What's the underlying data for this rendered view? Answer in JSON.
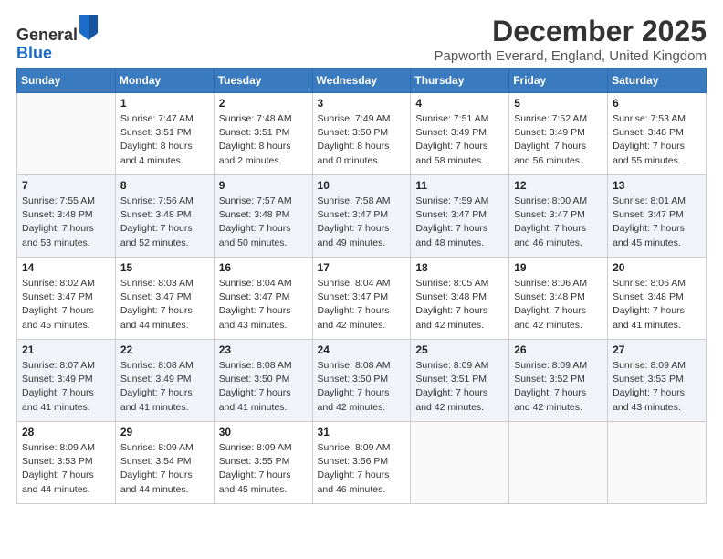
{
  "logo": {
    "line1": "General",
    "line2": "Blue"
  },
  "title": "December 2025",
  "location": "Papworth Everard, England, United Kingdom",
  "days_of_week": [
    "Sunday",
    "Monday",
    "Tuesday",
    "Wednesday",
    "Thursday",
    "Friday",
    "Saturday"
  ],
  "weeks": [
    [
      {
        "day": "",
        "sunrise": "",
        "sunset": "",
        "daylight": "",
        "empty": true
      },
      {
        "day": "1",
        "sunrise": "Sunrise: 7:47 AM",
        "sunset": "Sunset: 3:51 PM",
        "daylight": "Daylight: 8 hours and 4 minutes.",
        "empty": false
      },
      {
        "day": "2",
        "sunrise": "Sunrise: 7:48 AM",
        "sunset": "Sunset: 3:51 PM",
        "daylight": "Daylight: 8 hours and 2 minutes.",
        "empty": false
      },
      {
        "day": "3",
        "sunrise": "Sunrise: 7:49 AM",
        "sunset": "Sunset: 3:50 PM",
        "daylight": "Daylight: 8 hours and 0 minutes.",
        "empty": false
      },
      {
        "day": "4",
        "sunrise": "Sunrise: 7:51 AM",
        "sunset": "Sunset: 3:49 PM",
        "daylight": "Daylight: 7 hours and 58 minutes.",
        "empty": false
      },
      {
        "day": "5",
        "sunrise": "Sunrise: 7:52 AM",
        "sunset": "Sunset: 3:49 PM",
        "daylight": "Daylight: 7 hours and 56 minutes.",
        "empty": false
      },
      {
        "day": "6",
        "sunrise": "Sunrise: 7:53 AM",
        "sunset": "Sunset: 3:48 PM",
        "daylight": "Daylight: 7 hours and 55 minutes.",
        "empty": false
      }
    ],
    [
      {
        "day": "7",
        "sunrise": "Sunrise: 7:55 AM",
        "sunset": "Sunset: 3:48 PM",
        "daylight": "Daylight: 7 hours and 53 minutes.",
        "empty": false
      },
      {
        "day": "8",
        "sunrise": "Sunrise: 7:56 AM",
        "sunset": "Sunset: 3:48 PM",
        "daylight": "Daylight: 7 hours and 52 minutes.",
        "empty": false
      },
      {
        "day": "9",
        "sunrise": "Sunrise: 7:57 AM",
        "sunset": "Sunset: 3:48 PM",
        "daylight": "Daylight: 7 hours and 50 minutes.",
        "empty": false
      },
      {
        "day": "10",
        "sunrise": "Sunrise: 7:58 AM",
        "sunset": "Sunset: 3:47 PM",
        "daylight": "Daylight: 7 hours and 49 minutes.",
        "empty": false
      },
      {
        "day": "11",
        "sunrise": "Sunrise: 7:59 AM",
        "sunset": "Sunset: 3:47 PM",
        "daylight": "Daylight: 7 hours and 48 minutes.",
        "empty": false
      },
      {
        "day": "12",
        "sunrise": "Sunrise: 8:00 AM",
        "sunset": "Sunset: 3:47 PM",
        "daylight": "Daylight: 7 hours and 46 minutes.",
        "empty": false
      },
      {
        "day": "13",
        "sunrise": "Sunrise: 8:01 AM",
        "sunset": "Sunset: 3:47 PM",
        "daylight": "Daylight: 7 hours and 45 minutes.",
        "empty": false
      }
    ],
    [
      {
        "day": "14",
        "sunrise": "Sunrise: 8:02 AM",
        "sunset": "Sunset: 3:47 PM",
        "daylight": "Daylight: 7 hours and 45 minutes.",
        "empty": false
      },
      {
        "day": "15",
        "sunrise": "Sunrise: 8:03 AM",
        "sunset": "Sunset: 3:47 PM",
        "daylight": "Daylight: 7 hours and 44 minutes.",
        "empty": false
      },
      {
        "day": "16",
        "sunrise": "Sunrise: 8:04 AM",
        "sunset": "Sunset: 3:47 PM",
        "daylight": "Daylight: 7 hours and 43 minutes.",
        "empty": false
      },
      {
        "day": "17",
        "sunrise": "Sunrise: 8:04 AM",
        "sunset": "Sunset: 3:47 PM",
        "daylight": "Daylight: 7 hours and 42 minutes.",
        "empty": false
      },
      {
        "day": "18",
        "sunrise": "Sunrise: 8:05 AM",
        "sunset": "Sunset: 3:48 PM",
        "daylight": "Daylight: 7 hours and 42 minutes.",
        "empty": false
      },
      {
        "day": "19",
        "sunrise": "Sunrise: 8:06 AM",
        "sunset": "Sunset: 3:48 PM",
        "daylight": "Daylight: 7 hours and 42 minutes.",
        "empty": false
      },
      {
        "day": "20",
        "sunrise": "Sunrise: 8:06 AM",
        "sunset": "Sunset: 3:48 PM",
        "daylight": "Daylight: 7 hours and 41 minutes.",
        "empty": false
      }
    ],
    [
      {
        "day": "21",
        "sunrise": "Sunrise: 8:07 AM",
        "sunset": "Sunset: 3:49 PM",
        "daylight": "Daylight: 7 hours and 41 minutes.",
        "empty": false
      },
      {
        "day": "22",
        "sunrise": "Sunrise: 8:08 AM",
        "sunset": "Sunset: 3:49 PM",
        "daylight": "Daylight: 7 hours and 41 minutes.",
        "empty": false
      },
      {
        "day": "23",
        "sunrise": "Sunrise: 8:08 AM",
        "sunset": "Sunset: 3:50 PM",
        "daylight": "Daylight: 7 hours and 41 minutes.",
        "empty": false
      },
      {
        "day": "24",
        "sunrise": "Sunrise: 8:08 AM",
        "sunset": "Sunset: 3:50 PM",
        "daylight": "Daylight: 7 hours and 42 minutes.",
        "empty": false
      },
      {
        "day": "25",
        "sunrise": "Sunrise: 8:09 AM",
        "sunset": "Sunset: 3:51 PM",
        "daylight": "Daylight: 7 hours and 42 minutes.",
        "empty": false
      },
      {
        "day": "26",
        "sunrise": "Sunrise: 8:09 AM",
        "sunset": "Sunset: 3:52 PM",
        "daylight": "Daylight: 7 hours and 42 minutes.",
        "empty": false
      },
      {
        "day": "27",
        "sunrise": "Sunrise: 8:09 AM",
        "sunset": "Sunset: 3:53 PM",
        "daylight": "Daylight: 7 hours and 43 minutes.",
        "empty": false
      }
    ],
    [
      {
        "day": "28",
        "sunrise": "Sunrise: 8:09 AM",
        "sunset": "Sunset: 3:53 PM",
        "daylight": "Daylight: 7 hours and 44 minutes.",
        "empty": false
      },
      {
        "day": "29",
        "sunrise": "Sunrise: 8:09 AM",
        "sunset": "Sunset: 3:54 PM",
        "daylight": "Daylight: 7 hours and 44 minutes.",
        "empty": false
      },
      {
        "day": "30",
        "sunrise": "Sunrise: 8:09 AM",
        "sunset": "Sunset: 3:55 PM",
        "daylight": "Daylight: 7 hours and 45 minutes.",
        "empty": false
      },
      {
        "day": "31",
        "sunrise": "Sunrise: 8:09 AM",
        "sunset": "Sunset: 3:56 PM",
        "daylight": "Daylight: 7 hours and 46 minutes.",
        "empty": false
      },
      {
        "day": "",
        "sunrise": "",
        "sunset": "",
        "daylight": "",
        "empty": true
      },
      {
        "day": "",
        "sunrise": "",
        "sunset": "",
        "daylight": "",
        "empty": true
      },
      {
        "day": "",
        "sunrise": "",
        "sunset": "",
        "daylight": "",
        "empty": true
      }
    ]
  ]
}
